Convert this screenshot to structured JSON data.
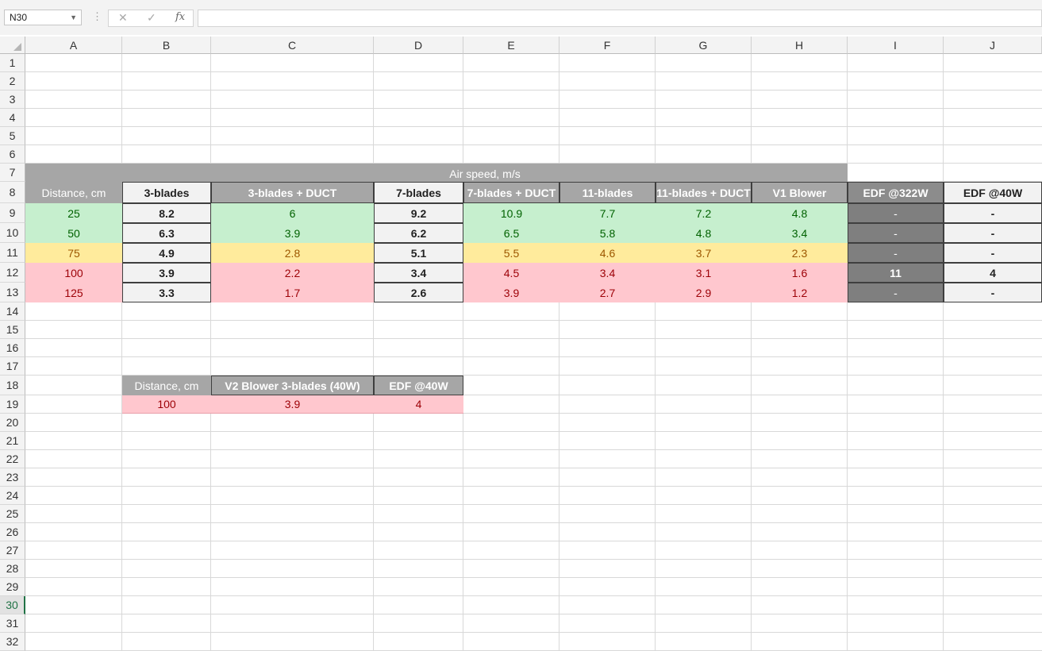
{
  "formula_bar": {
    "name_box": "N30",
    "cancel_icon": "cancel-x-icon",
    "enter_icon": "check-icon",
    "fx_label": "fx",
    "formula": ""
  },
  "sheet": {
    "columns": [
      "A",
      "B",
      "C",
      "D",
      "E",
      "F",
      "G",
      "H",
      "I",
      "J"
    ],
    "rows": [
      "1",
      "2",
      "3",
      "4",
      "5",
      "6",
      "7",
      "8",
      "9",
      "10",
      "11",
      "12",
      "13",
      "14",
      "15",
      "16",
      "17",
      "18",
      "19",
      "20",
      "21",
      "22",
      "23",
      "24",
      "25",
      "26",
      "27",
      "28",
      "29",
      "30",
      "31",
      "32"
    ],
    "active_row": "30"
  },
  "table1": {
    "title": "Air speed, m/s",
    "headers": [
      "Distance, cm",
      "3-blades",
      "3-blades + DUCT",
      "7-blades",
      "7-blades + DUCT",
      "11-blades",
      "11-blades + DUCT",
      "V1 Blower",
      "EDF @322W",
      "EDF @40W"
    ],
    "rows": [
      [
        "25",
        "8.2",
        "6",
        "9.2",
        "10.9",
        "7.7",
        "7.2",
        "4.8",
        "-",
        "-"
      ],
      [
        "50",
        "6.3",
        "3.9",
        "6.2",
        "6.5",
        "5.8",
        "4.8",
        "3.4",
        "-",
        "-"
      ],
      [
        "75",
        "4.9",
        "2.8",
        "5.1",
        "5.5",
        "4.6",
        "3.7",
        "2.3",
        "-",
        "-"
      ],
      [
        "100",
        "3.9",
        "2.2",
        "3.4",
        "4.5",
        "3.4",
        "3.1",
        "1.6",
        "11",
        "4"
      ],
      [
        "125",
        "3.3",
        "1.7",
        "2.6",
        "3.9",
        "2.7",
        "2.9",
        "1.2",
        "-",
        "-"
      ]
    ]
  },
  "table2": {
    "headers": [
      "Distance, cm",
      "V2 Blower 3-blades (40W)",
      "EDF @40W"
    ],
    "row": [
      "100",
      "3.9",
      "4"
    ]
  },
  "colors": {
    "green_fill": "#c6efce",
    "green_text": "#006100",
    "yellow_fill": "#ffeb9c",
    "yellow_text": "#9c5700",
    "red_fill": "#ffc7ce",
    "red_text": "#9c0006",
    "header_grey": "#a6a6a6",
    "dark_grey": "#7f7f7f",
    "excel_green": "#217346"
  }
}
